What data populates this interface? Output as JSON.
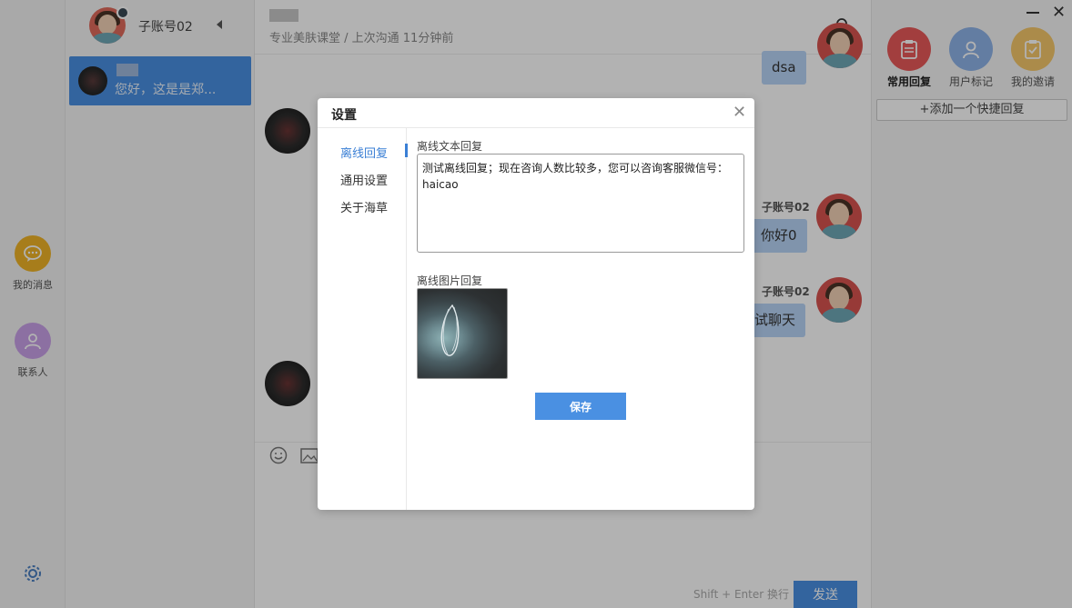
{
  "navbar": {
    "messages_label": "我的消息",
    "contacts_label": "联系人",
    "messages_icon": "chat-bubble-icon",
    "contacts_icon": "user-icon",
    "settings_icon": "gear-icon"
  },
  "sessions": {
    "account_name": "子账号02",
    "items": [
      {
        "preview": "您好，这是是郑..."
      }
    ]
  },
  "chat": {
    "subtitle": "专业美肤课堂 / 上次沟通 11分钟前",
    "messages": [
      {
        "text": "dsa"
      },
      {
        "sender": "子账号02",
        "text": "你好0"
      },
      {
        "sender": "子账号02",
        "text": "试聊天"
      }
    ],
    "send_hint": "Shift + Enter 换行",
    "send_label": "发送"
  },
  "right_panel": {
    "tools": [
      {
        "label": "常用回复",
        "icon": "clipboard-icon"
      },
      {
        "label": "用户标记",
        "icon": "user-icon"
      },
      {
        "label": "我的邀请",
        "icon": "clipboard-check-icon"
      }
    ],
    "add_quick_reply": "+添加一个快捷回复"
  },
  "modal": {
    "title": "设置",
    "tabs": [
      {
        "label": "离线回复",
        "active": true
      },
      {
        "label": "通用设置",
        "active": false
      },
      {
        "label": "关于海草",
        "active": false
      }
    ],
    "text_reply_label": "离线文本回复",
    "text_reply_value": "测试离线回复；现在咨询人数比较多，您可以咨询客服微信号：haicao",
    "image_reply_label": "离线图片回复",
    "save_label": "保存"
  },
  "colors": {
    "accent": "#4a90e2",
    "active_tab": "#3a7fd5"
  }
}
